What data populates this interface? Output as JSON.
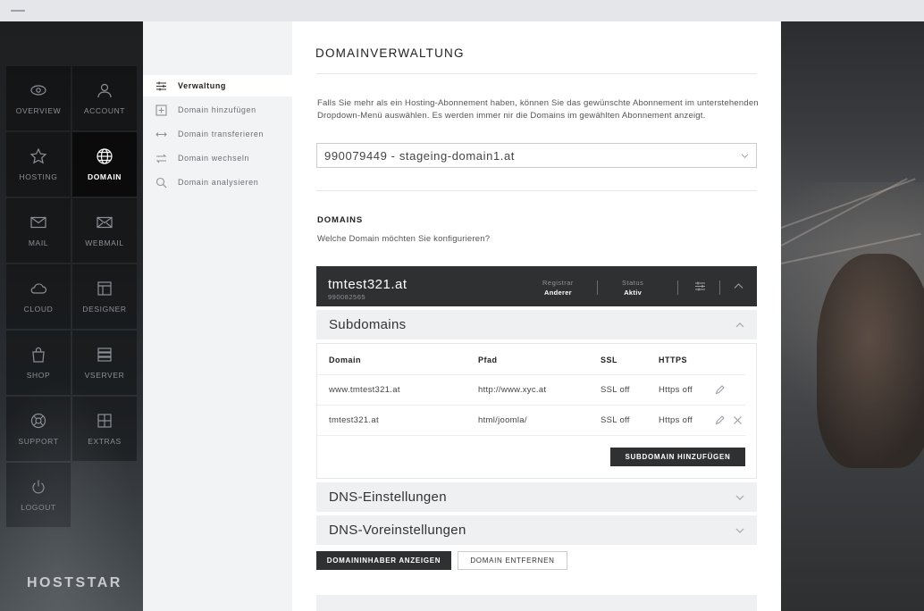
{
  "rail": {
    "tiles": [
      {
        "label": "OVERVIEW",
        "icon": "eye-icon"
      },
      {
        "label": "ACCOUNT",
        "icon": "user-icon"
      },
      {
        "label": "HOSTING",
        "icon": "star-icon"
      },
      {
        "label": "DOMAIN",
        "icon": "globe-icon",
        "active": true
      },
      {
        "label": "MAIL",
        "icon": "envelope-icon"
      },
      {
        "label": "WEBMAIL",
        "icon": "open-envelope-icon"
      },
      {
        "label": "CLOUD",
        "icon": "cloud-icon"
      },
      {
        "label": "DESIGNER",
        "icon": "layout-icon"
      },
      {
        "label": "SHOP",
        "icon": "bag-icon"
      },
      {
        "label": "VSERVER",
        "icon": "server-icon"
      },
      {
        "label": "SUPPORT",
        "icon": "lifebuoy-icon"
      },
      {
        "label": "EXTRAS",
        "icon": "grid-icon"
      },
      {
        "label": "LOGOUT",
        "icon": "power-icon"
      }
    ],
    "logo": "HOSTSTAR"
  },
  "subnav": {
    "items": [
      {
        "label": "Verwaltung",
        "icon": "sliders-icon",
        "active": true
      },
      {
        "label": "Domain hinzufügen",
        "icon": "plus-box-icon"
      },
      {
        "label": "Domain transferieren",
        "icon": "transfer-arrows-icon"
      },
      {
        "label": "Domain wechseln",
        "icon": "switch-arrows-icon"
      },
      {
        "label": "Domain analysieren",
        "icon": "search-icon"
      }
    ]
  },
  "main": {
    "title": "DOMAINVERWALTUNG",
    "intro": "Falls Sie mehr als ein Hosting-Abonnement haben, können Sie das gewünschte Abonnement im unterstehenden Dropdown-Menü auswählen. Es werden immer nir die Domains im gewählten Abonnement anzeigt.",
    "subscription_select": "990079449 - stageing-domain1.at",
    "domains_heading": "DOMAINS",
    "domains_question": "Welche Domain möchten Sie konfigurieren?",
    "domain": {
      "name": "tmtest321.at",
      "id": "990082565",
      "registrar_label": "Registrar",
      "registrar_value": "Anderer",
      "status_label": "Status",
      "status_value": "Aktiv"
    },
    "subdomains": {
      "title": "Subdomains",
      "columns": [
        "Domain",
        "Pfad",
        "SSL",
        "HTTPS"
      ],
      "rows": [
        {
          "domain": "www.tmtest321.at",
          "path": "http://www.xyc.at",
          "ssl": "SSL off",
          "https": "Https off"
        },
        {
          "domain": "tmtest321.at",
          "path": "html/joomla/",
          "ssl": "SSL off",
          "https": "Https off"
        }
      ],
      "add_button": "SUBDOMAIN HINZUFÜGEN"
    },
    "dns_settings": "DNS-Einstellungen",
    "dns_presets": "DNS-Voreinstellungen",
    "owner_button": "DOMAININHABER ANZEIGEN",
    "remove_button": "DOMAIN ENTFERNEN"
  }
}
